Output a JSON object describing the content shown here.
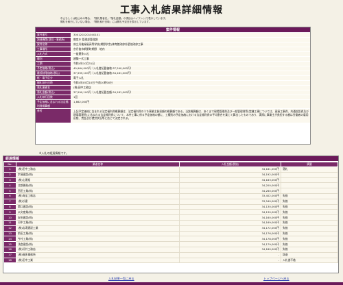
{
  "title": "工事入札結果詳細情報",
  "notes": [
    "中止もしくは取止めの場合、「落札業者名」「落札金額」の項目はハイフン(-)で表示しています。",
    "開札を執行していない場合、「開札執行日時」には開札予定日を表示しています。"
  ],
  "info": {
    "header": "案件情報",
    "rows": [
      {
        "k": "案件番号",
        "v": "3001202201040101"
      },
      {
        "k": "調達機関(部局・事務所)",
        "v": "教育庁 管理部管理課"
      },
      {
        "k": "案件名称",
        "v": "府立丹後緑風高等学校(網野学舎)体育館改修外壁他改修工事"
      },
      {
        "k": "工事場所",
        "v": "京丹後市網野町網野　地内"
      },
      {
        "k": "入札方式",
        "v": "一般競争入札"
      },
      {
        "k": "種別",
        "v": "建築一式工事"
      },
      {
        "k": "工期",
        "v": "令和4年10月31日"
      },
      {
        "k": "予定価格(税込)",
        "v": "40,964,000円（入札書記載価格:37,240,000円）"
      },
      {
        "k": "最低制限価格(税込)",
        "v": "37,599,100円（入札書記載価格:34,181,000円）"
      },
      {
        "k": "紙・電子区分",
        "v": "電子入札"
      },
      {
        "k": "開札執行日時",
        "v": "令和4年05月10日 午前10時00分"
      },
      {
        "k": "落札業者名",
        "v": "(株)田中工務店"
      },
      {
        "k": "落札金額(税込)",
        "v": "37,599,100円（入札書記載金額:34,181,000円）"
      },
      {
        "k": "入札執行回数",
        "v": "1回"
      },
      {
        "k": "予定価格に含まれる法定福利費概算額",
        "v": "1,862,000円"
      },
      {
        "k": "参考",
        "v": "上記予定価格に含まれる法定福利費概算額は、法定福利費のうち事業主負担額の概算額である。当該概算額は、あくまで現場管理費及び一般管理費等(営繕工事については、直接工事費、共通仮設費及び現場管理費)に含まれる法定福利費について、本件工事に係る予定価格の額に、工種別の予定価格における法定福利費の平均割合を乗じて算出したものであり、実際に事業主が負担する額は労働者の雇用形態、賃金及び就労状況等に応じて決定される。"
      }
    ]
  },
  "note2": "※入札の経過情報です。",
  "bids": {
    "header": "経過情報",
    "columns": [
      "No.",
      "業者名称",
      "入札金額(税抜)",
      "摘要"
    ],
    "rows": [
      {
        "no": "1",
        "name": "(株)田中工務店",
        "amt": "34,181,000円",
        "note": "落札"
      },
      {
        "no": "2",
        "name": "宗清建設(株)",
        "amt": "34,192,000円",
        "note": ""
      },
      {
        "no": "3",
        "name": "(株)山運組",
        "amt": "34,183,000円",
        "note": ""
      },
      {
        "no": "4",
        "name": "北都開発(株)",
        "amt": "34,200,000円",
        "note": ""
      },
      {
        "no": "5",
        "name": "西田工業(株)",
        "amt": "34,260,000円",
        "note": ""
      },
      {
        "no": "6",
        "name": "(株)海宝工務店",
        "amt": "33,402,000円",
        "note": "失格"
      },
      {
        "no": "7",
        "name": "(株)杉建",
        "amt": "33,540,000円",
        "note": "失格"
      },
      {
        "no": "8",
        "name": "関口建設(株)",
        "amt": "34,130,000円",
        "note": "失格"
      },
      {
        "no": "9",
        "name": "公文産業(株)",
        "amt": "34,130,000円",
        "note": "失格"
      },
      {
        "no": "10",
        "name": "安田建設(株)",
        "amt": "34,160,000円",
        "note": "失格"
      },
      {
        "no": "11",
        "name": "河中工業(株)",
        "amt": "34,169,000円",
        "note": "失格"
      },
      {
        "no": "12",
        "name": "(株)岩滝建設工業",
        "amt": "34,172,000円",
        "note": "失格"
      },
      {
        "no": "13",
        "name": "前田工業(株)",
        "amt": "34,176,000円",
        "note": "失格"
      },
      {
        "no": "14",
        "name": "今村工業(株)",
        "amt": "34,178,000円",
        "note": "失格"
      },
      {
        "no": "15",
        "name": "浅倉建設(株)",
        "amt": "34,179,000円",
        "note": "失格"
      },
      {
        "no": "16",
        "name": "(株)好井工務店",
        "amt": "34,180,000円",
        "note": "失格"
      },
      {
        "no": "17",
        "name": "(株)福多事務所",
        "amt": "-",
        "note": "辞退"
      },
      {
        "no": "18",
        "name": "(株)田中工業",
        "amt": "-",
        "note": "入札書不着"
      }
    ]
  },
  "links": {
    "back": "入札結果一覧に戻る",
    "top": "トップページへ戻る"
  }
}
